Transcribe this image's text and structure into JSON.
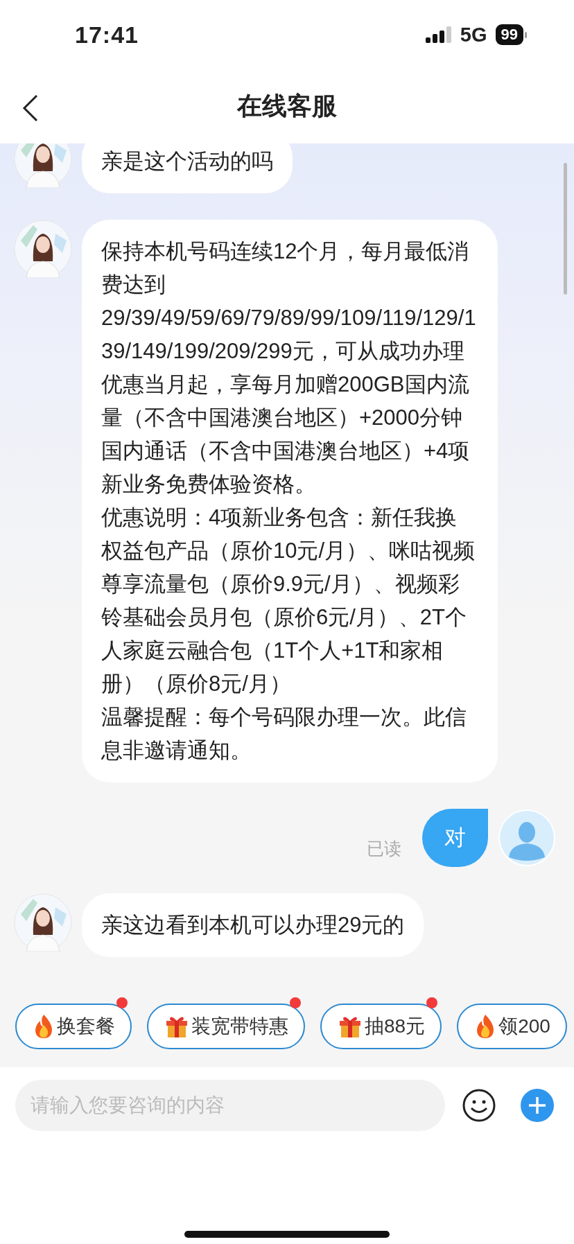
{
  "status_bar": {
    "time": "17:41",
    "network": "5G",
    "battery": "99"
  },
  "nav": {
    "title": "在线客服"
  },
  "messages": [
    {
      "kind": "agent",
      "paragraphs": [
        "亲是这个活动的吗"
      ]
    },
    {
      "kind": "agent",
      "paragraphs": [
        "保持本机号码连续12个月，每月最低消费达到29/39/49/59/69/79/89/99/109/119/129/139/149/199/209/299元，可从成功办理优惠当月起，享每月加赠200GB国内流量（不含中国港澳台地区）+2000分钟国内通话（不含中国港澳台地区）+4项新业务免费体验资格。",
        "优惠说明：4项新业务包含：新任我换权益包产品（原价10元/月）、咪咕视频尊享流量包（原价9.9元/月）、视频彩铃基础会员月包（原价6元/月）、2T个人家庭云融合包（1T个人+1T和家相册）（原价8元/月）",
        "温馨提醒：每个号码限办理一次。此信息非邀请通知。"
      ]
    },
    {
      "kind": "user",
      "paragraphs": [
        "对"
      ],
      "read_status": "已读"
    },
    {
      "kind": "agent",
      "paragraphs": [
        "亲这边看到本机可以办理29元的"
      ]
    }
  ],
  "quick_replies": [
    {
      "kind": "fire",
      "label": "换套餐",
      "badge": true
    },
    {
      "kind": "gift",
      "label": "装宽带特惠",
      "badge": true
    },
    {
      "kind": "gift",
      "label": "抽88元",
      "badge": true
    },
    {
      "kind": "fire",
      "label": "领200",
      "badge": false
    }
  ],
  "input": {
    "placeholder": "请输入您要咨询的内容"
  }
}
